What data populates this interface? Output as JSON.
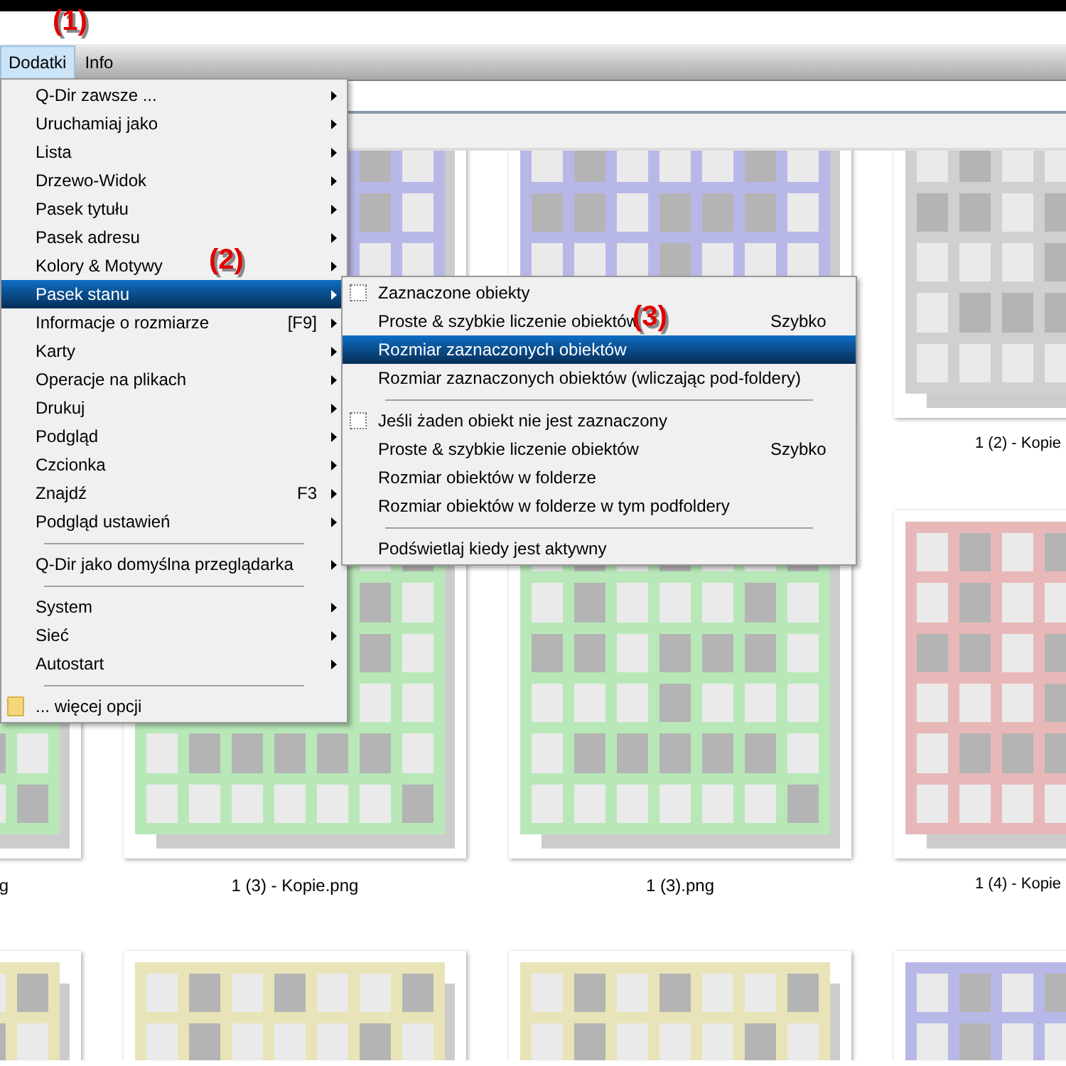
{
  "menu_bar": [
    {
      "label": "Dodatki",
      "selected": true
    },
    {
      "label": "Info",
      "selected": false
    }
  ],
  "menu": {
    "items": [
      {
        "kind": "item",
        "label": "Q-Dir zawsze ...",
        "submenu": true,
        "selected": false
      },
      {
        "kind": "item",
        "label": "Uruchamiaj jako",
        "submenu": true,
        "selected": false
      },
      {
        "kind": "item",
        "label": "Lista",
        "submenu": true,
        "selected": false
      },
      {
        "kind": "item",
        "label": "Drzewo-Widok",
        "submenu": true,
        "selected": false
      },
      {
        "kind": "item",
        "label": "Pasek tytułu",
        "submenu": true,
        "selected": false
      },
      {
        "kind": "item",
        "label": "Pasek adresu",
        "submenu": true,
        "selected": false
      },
      {
        "kind": "item",
        "label": "Kolory & Motywy",
        "submenu": true,
        "selected": false
      },
      {
        "kind": "item",
        "label": "Pasek stanu",
        "submenu": true,
        "selected": true
      },
      {
        "kind": "item",
        "label": "Informacje o rozmiarze",
        "shortcut": "[F9]",
        "submenu": true,
        "selected": false
      },
      {
        "kind": "item",
        "label": "Karty",
        "submenu": true,
        "selected": false
      },
      {
        "kind": "item",
        "label": "Operacje na plikach",
        "submenu": true,
        "selected": false
      },
      {
        "kind": "item",
        "label": "Drukuj",
        "submenu": true,
        "selected": false
      },
      {
        "kind": "item",
        "label": "Podgląd",
        "submenu": true,
        "selected": false
      },
      {
        "kind": "item",
        "label": "Czcionka",
        "submenu": true,
        "selected": false
      },
      {
        "kind": "item",
        "label": "Znajdź",
        "shortcut": "F3",
        "submenu": true,
        "selected": false
      },
      {
        "kind": "item",
        "label": "Podgląd ustawień",
        "submenu": true,
        "selected": false
      },
      {
        "kind": "separator"
      },
      {
        "kind": "item",
        "label": "Q-Dir jako domyślna przeglądarka",
        "submenu": true,
        "selected": false
      },
      {
        "kind": "separator"
      },
      {
        "kind": "item",
        "label": "System",
        "submenu": true,
        "selected": false
      },
      {
        "kind": "item",
        "label": "Sieć",
        "submenu": true,
        "selected": false
      },
      {
        "kind": "item",
        "label": "Autostart",
        "submenu": true,
        "selected": false
      },
      {
        "kind": "separator"
      },
      {
        "kind": "folder",
        "label": "... więcej opcji",
        "submenu": false,
        "selected": false
      }
    ]
  },
  "submenu": {
    "items": [
      {
        "kind": "check",
        "label": "Zaznaczone obiekty",
        "checked": false,
        "selected": false
      },
      {
        "kind": "item",
        "label": "Proste & szybkie liczenie obiektów",
        "value": "Szybko",
        "selected": false
      },
      {
        "kind": "item",
        "label": "Rozmiar zaznaczonych obiektów",
        "selected": true
      },
      {
        "kind": "item",
        "label": "Rozmiar zaznaczonych obiektów (wliczając pod-foldery)",
        "selected": false
      },
      {
        "kind": "separator"
      },
      {
        "kind": "check",
        "label": "Jeśli żaden obiekt nie jest zaznaczony",
        "checked": false,
        "selected": false
      },
      {
        "kind": "item",
        "label": "Proste & szybkie liczenie obiektów",
        "value": "Szybko",
        "selected": false
      },
      {
        "kind": "item",
        "label": "Rozmiar obiektów w folderze",
        "selected": false
      },
      {
        "kind": "item",
        "label": "Rozmiar obiektów w folderze w tym podfoldery",
        "selected": false
      },
      {
        "kind": "separator"
      },
      {
        "kind": "item",
        "label": "Podświetlaj kiedy jest aktywny",
        "selected": false
      }
    ]
  },
  "thumbnails": [
    [
      {
        "color": "#b8b8e8"
      },
      {
        "color": "#b8b8e8"
      },
      {
        "color": "#d0d0d0",
        "label": "1 (2) - Kopie"
      }
    ],
    [
      {
        "color": "#b8e8b8",
        "label": "g"
      },
      {
        "color": "#b8e8b8",
        "label": "1 (3) - Kopie.png"
      },
      {
        "color": "#b8e8b8",
        "label": "1 (3).png"
      },
      {
        "color": "#e8b8b8",
        "label": "1 (4) - Kopie"
      }
    ],
    [
      {
        "color": "#e8e4b8"
      },
      {
        "color": "#e8e4b8"
      },
      {
        "color": "#e8e4b8"
      },
      {
        "color": "#b8b8e8"
      }
    ]
  ],
  "callouts": [
    "(1)",
    "(2)",
    "(3)"
  ]
}
